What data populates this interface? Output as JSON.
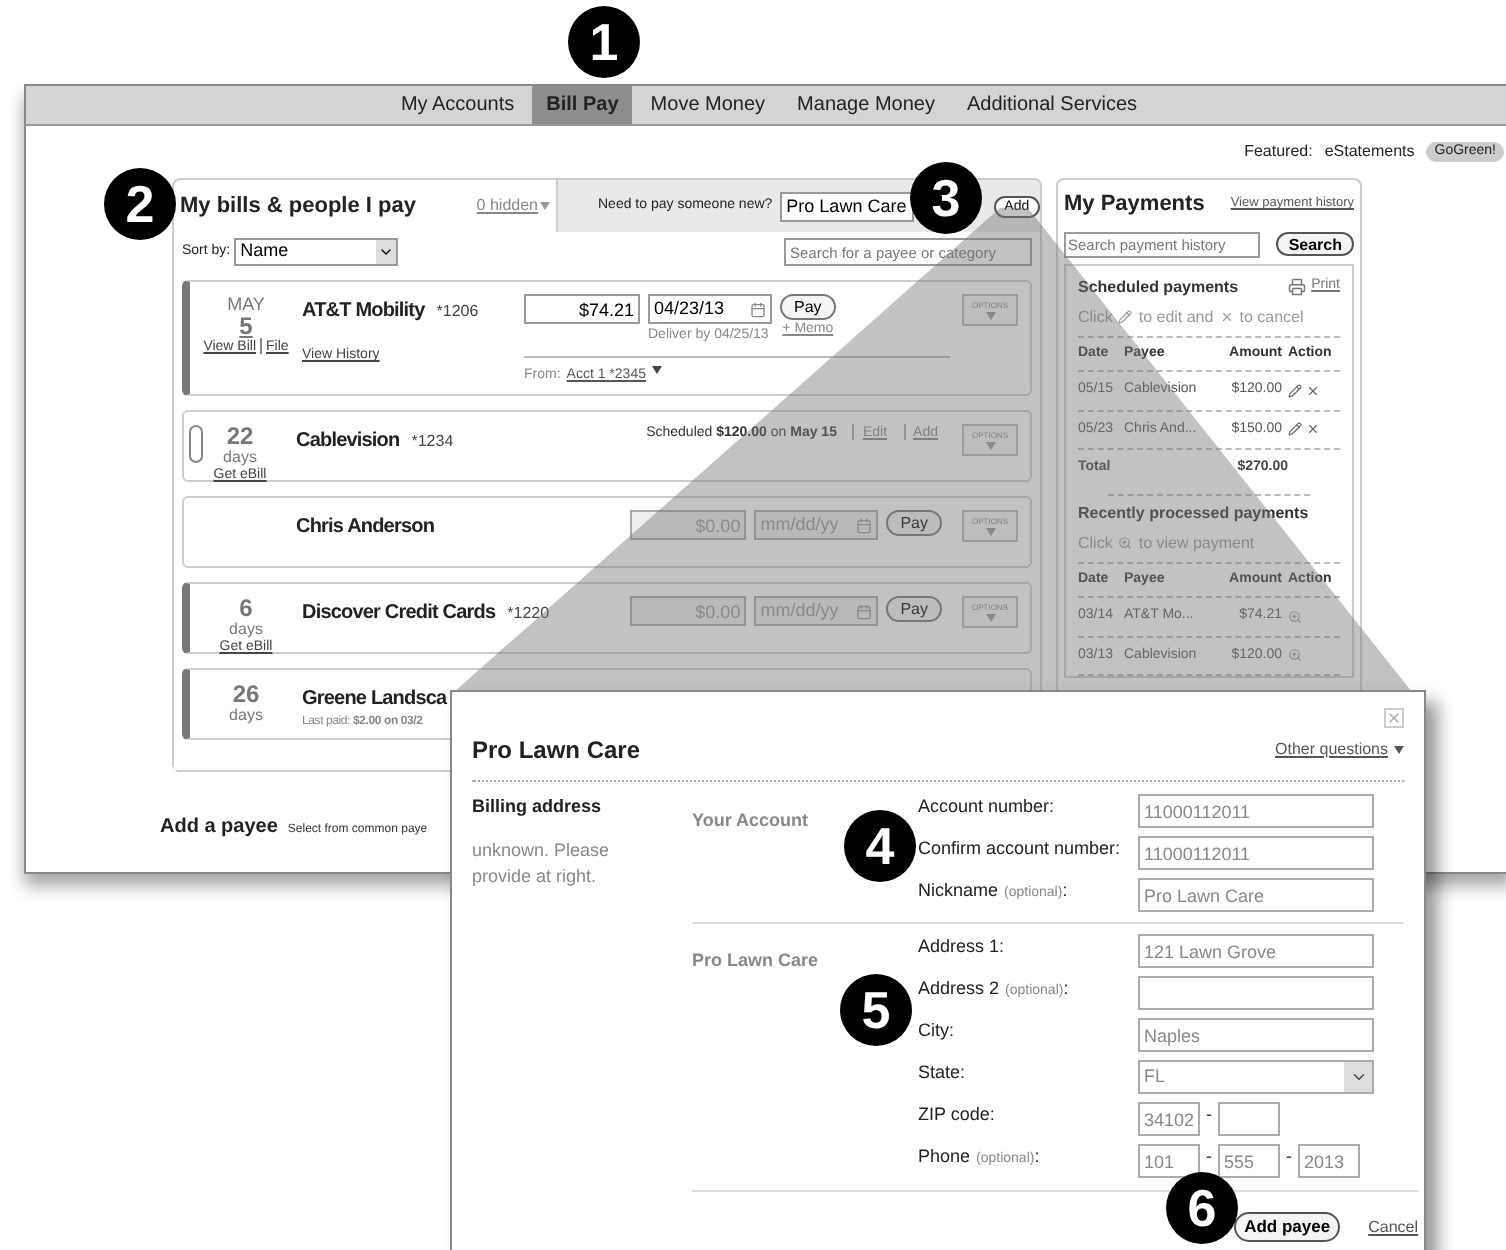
{
  "callouts": [
    "1",
    "2",
    "3",
    "4",
    "5",
    "6"
  ],
  "nav": {
    "items": [
      {
        "label": "My Accounts",
        "selected": false
      },
      {
        "label": "Bill Pay",
        "selected": true
      },
      {
        "label": "Move Money",
        "selected": false
      },
      {
        "label": "Manage Money",
        "selected": false
      },
      {
        "label": "Additional Services",
        "selected": false
      }
    ]
  },
  "featured": {
    "label": "Featured:",
    "item": "eStatements",
    "badge": "GoGreen!"
  },
  "bills": {
    "title": "My bills & people I pay",
    "hidden_link": "0 hidden",
    "new_payee_prompt": "Need to pay someone new?",
    "new_payee_value": "Pro Lawn Care",
    "add_button": "Add",
    "sort_label": "Sort by:",
    "sort_value": "Name",
    "search_placeholder": "Search for a payee or category",
    "rows": [
      {
        "kind": "due",
        "flagged": true,
        "month": "MAY",
        "day": "5",
        "links": [
          "View Bill",
          "File"
        ],
        "name": "AT&T Mobility",
        "account": "*1206",
        "sublink": "View History",
        "amount": "$74.21",
        "date": "04/23/13",
        "pay": "Pay",
        "memo": "+ Memo",
        "deliver": "Deliver by 04/25/13",
        "from_label": "From:",
        "from_account": "Acct 1 *2345",
        "options": "OPTIONS"
      },
      {
        "kind": "scheduled",
        "flagged": false,
        "days": "22",
        "days_label": "days",
        "link": "Get eBill",
        "name": "Cablevision",
        "account": "*1234",
        "scheduled": "Scheduled **$120.00** on **May 15**",
        "actions": [
          "Edit",
          "Add"
        ],
        "options": "OPTIONS"
      },
      {
        "kind": "pay",
        "flagged": false,
        "name": "Chris Anderson",
        "amount_placeholder": "$0.00",
        "date_placeholder": "mm/dd/yy",
        "pay": "Pay",
        "options": "OPTIONS"
      },
      {
        "kind": "pay",
        "flagged": true,
        "days": "6",
        "days_label": "days",
        "link": "Get eBill",
        "name": "Discover Credit Cards",
        "account": "*1220",
        "amount_placeholder": "$0.00",
        "date_placeholder": "mm/dd/yy",
        "pay": "Pay",
        "options": "OPTIONS"
      },
      {
        "kind": "last_paid",
        "flagged": true,
        "days": "26",
        "days_label": "days",
        "name": "Greene Landsca",
        "last_paid": "Last paid: **$2.00 on 03/2**"
      }
    ]
  },
  "add_payee": {
    "title": "Add a payee",
    "hint": "Select from common paye"
  },
  "payments": {
    "title": "My Payments",
    "link": "View payment history",
    "search_placeholder": "Search payment history",
    "search_button": "Search",
    "scheduled": {
      "title": "Scheduled payments",
      "print": "Print",
      "hint": [
        "Click",
        "to edit and",
        "to cancel"
      ],
      "columns": [
        "Date",
        "Payee",
        "Amount",
        "Action"
      ],
      "rows": [
        {
          "date": "05/15",
          "payee": "Cablevision",
          "amount": "$120.00"
        },
        {
          "date": "05/23",
          "payee": "Chris And...",
          "amount": "$150.00"
        }
      ],
      "total_label": "Total",
      "total": "$270.00"
    },
    "recent": {
      "title": "Recently processed payments",
      "hint": [
        "Click",
        "to view payment"
      ],
      "columns": [
        "Date",
        "Payee",
        "Amount",
        "Action"
      ],
      "rows": [
        {
          "date": "03/14",
          "payee": "AT&T Mo...",
          "amount": "$74.21"
        },
        {
          "date": "03/13",
          "payee": "Cablevision",
          "amount": "$120.00"
        }
      ]
    }
  },
  "popup": {
    "title": "Pro Lawn Care",
    "other_questions": "Other questions",
    "side_title": "Billing address",
    "side_note": "unknown. Please provide at right.",
    "groups": [
      {
        "title": "Your Account",
        "fields": [
          {
            "kind": "text",
            "label": "Account number:",
            "value": "11000112011"
          },
          {
            "kind": "text",
            "label": "Confirm account number:",
            "value": "11000112011"
          },
          {
            "kind": "text",
            "label": "Nickname",
            "optional": "(optional)",
            "colon": ":",
            "value": "Pro Lawn Care"
          }
        ]
      },
      {
        "title": "Pro Lawn Care",
        "fields": [
          {
            "kind": "text",
            "label": "Address 1:",
            "value": "121 Lawn Grove"
          },
          {
            "kind": "text",
            "label": "Address 2",
            "optional": "(optional)",
            "colon": ":"
          },
          {
            "kind": "text",
            "label": "City:",
            "value": "Naples"
          },
          {
            "kind": "select",
            "label": "State:",
            "value": "FL"
          },
          {
            "kind": "split",
            "label": "ZIP code:",
            "separator": "-",
            "parts": [
              {
                "value": "34102"
              },
              {
                "blank": true
              }
            ]
          },
          {
            "kind": "split",
            "label": "Phone",
            "optional": "(optional)",
            "colon": ":",
            "separator": "-",
            "parts": [
              {
                "value": "101"
              },
              {
                "value": "555"
              },
              {
                "value": "2013"
              }
            ]
          }
        ]
      }
    ],
    "submit": "Add payee",
    "cancel": "Cancel"
  }
}
